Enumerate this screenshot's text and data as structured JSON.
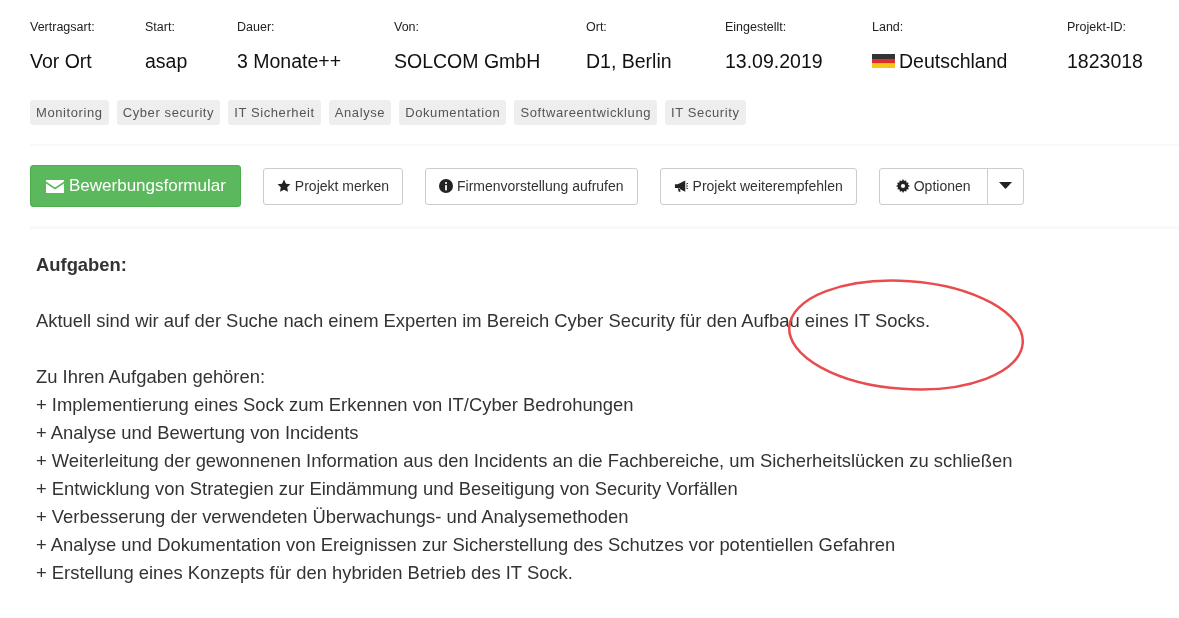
{
  "details": [
    {
      "label": "Vertragsart:",
      "value": "Vor Ort"
    },
    {
      "label": "Start:",
      "value": "asap"
    },
    {
      "label": "Dauer:",
      "value": "3 Monate++"
    },
    {
      "label": "Von:",
      "value": "SOLCOM GmbH"
    },
    {
      "label": "Ort:",
      "value": "D1, Berlin"
    },
    {
      "label": "Eingestellt:",
      "value": "13.09.2019"
    },
    {
      "label": "Land:",
      "value": "Deutschland",
      "kind": "country"
    },
    {
      "label": "Projekt-ID:",
      "value": "1823018"
    }
  ],
  "tags": [
    "Monitoring",
    "Cyber security",
    "IT Sicherheit",
    "Analyse",
    "Dokumentation",
    "Softwareentwicklung",
    "IT Security"
  ],
  "actions": [
    {
      "label": "Bewerbungsformular",
      "kind": "primary"
    },
    {
      "label": "Projekt merken",
      "kind": "default"
    },
    {
      "label": "Firmenvorstellung aufrufen",
      "kind": "default"
    },
    {
      "label": "Projekt weiterempfehlen",
      "kind": "default"
    },
    {
      "label": "Optionen",
      "kind": "split"
    }
  ],
  "description": {
    "heading": "Aufgaben:",
    "intro": "Aktuell sind wir auf der Suche nach einem Experten im Bereich Cyber Security für den Aufbau eines IT Socks.",
    "list_title": "Zu Ihren Aufgaben gehören:",
    "items": [
      "+ Implementierung eines Sock zum Erkennen von IT/Cyber Bedrohungen",
      "+ Analyse und Bewertung von Incidents",
      "+ Weiterleitung der gewonnenen Information aus den Incidents an die Fachbereiche, um Sicherheitslücken zu schließen",
      "+ Entwicklung von Strategien zur Eindämmung und Beseitigung von Security Vorfällen",
      "+ Verbesserung der verwendeten Überwachungs- und Analysemethoden",
      "+ Analyse und Dokumentation von Ereignissen zur Sicherstellung des Schutzes vor potentiellen Gefahren",
      "+ Erstellung eines Konzepts für den hybriden Betrieb des IT Sock."
    ]
  },
  "annotation": {
    "kind": "ellipse",
    "color": "#e84c4f"
  }
}
